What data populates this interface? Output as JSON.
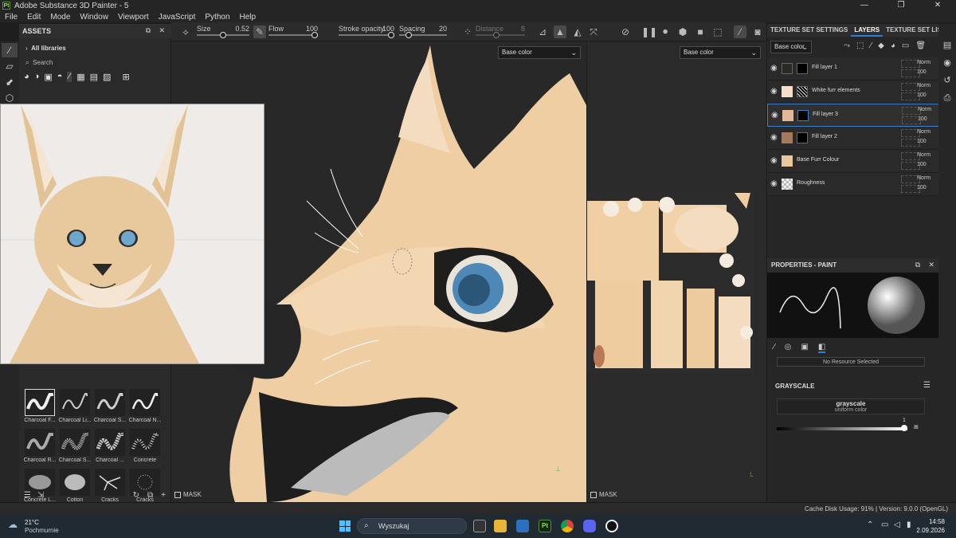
{
  "window": {
    "title": "Adobe Substance 3D Painter - 5",
    "app_badge": "Pt",
    "minimize": "—",
    "maximize": "❐",
    "close": "✕"
  },
  "menu": [
    "File",
    "Edit",
    "Mode",
    "Window",
    "Viewport",
    "JavaScript",
    "Python",
    "Help"
  ],
  "toolbar": {
    "size": {
      "label": "Size",
      "value": "0.52",
      "fraction": 0.5
    },
    "flow": {
      "label": "Flow",
      "value": "100",
      "fraction": 1.0
    },
    "stroke_opacity": {
      "label": "Stroke opacity",
      "value": "100",
      "fraction": 1.0
    },
    "spacing": {
      "label": "Spacing",
      "value": "20",
      "fraction": 0.15
    },
    "distance": {
      "label": "Distance",
      "value": "8"
    }
  },
  "assets": {
    "title": "ASSETS",
    "all_libraries": "All libraries",
    "search_placeholder": "Search",
    "brushes": [
      "Charcoal F...",
      "Charcoal Li...",
      "Charcoal S...",
      "Charcoal N...",
      "Charcoal R...",
      "Charcoal S...",
      "Charcoal ...",
      "Concrete",
      "Concrete L...",
      "Cotton",
      "Cracks",
      "Cracks"
    ]
  },
  "viewport3d": {
    "channel": "Base color",
    "mask_label": "MASK"
  },
  "viewport2d": {
    "channel": "Base color",
    "mask_label": "MASK"
  },
  "panel_tabs": [
    "TEXTURE SET SETTINGS",
    "LAYERS",
    "TEXTURE SET LIST"
  ],
  "layers_channel": "Base color",
  "layers": [
    {
      "name": "Fill layer 1",
      "swatch": "#2a2a22",
      "mask": "black",
      "blend": "Norm",
      "opacity": "100"
    },
    {
      "name": "White furr elements",
      "swatch": "#f3dfcb",
      "mask": "noise",
      "blend": "Norm",
      "opacity": "100"
    },
    {
      "name": "Fill layer 3",
      "swatch": "#e2b898",
      "mask": "black",
      "blend": "Norm",
      "opacity": "100",
      "selected": true
    },
    {
      "name": "Fill layer 2",
      "swatch": "#a57a5c",
      "mask": "black",
      "blend": "Norm",
      "opacity": "100"
    },
    {
      "name": "Base Furr Colour",
      "swatch": "#e8c79d",
      "mask": "",
      "blend": "Norm",
      "opacity": "100"
    },
    {
      "name": "Roughness",
      "swatch": "checker",
      "mask": "",
      "blend": "Norm",
      "opacity": "100"
    }
  ],
  "properties": {
    "title": "PROPERTIES - PAINT",
    "no_resource": "No Resource Selected",
    "grayscale_header": "GRAYSCALE",
    "grayscale_name": "grayscale",
    "grayscale_sub": "uniform color",
    "grayscale_value": "1",
    "grayscale_fraction": 1.0
  },
  "status": "Cache Disk Usage:   91% | Version: 9.0.0 (OpenGL)",
  "taskbar": {
    "weather_temp": "21°C",
    "weather_desc": "Pochmurnie",
    "search": "Wyszukaj",
    "time": "14:58",
    "date": "2.09.2026"
  }
}
